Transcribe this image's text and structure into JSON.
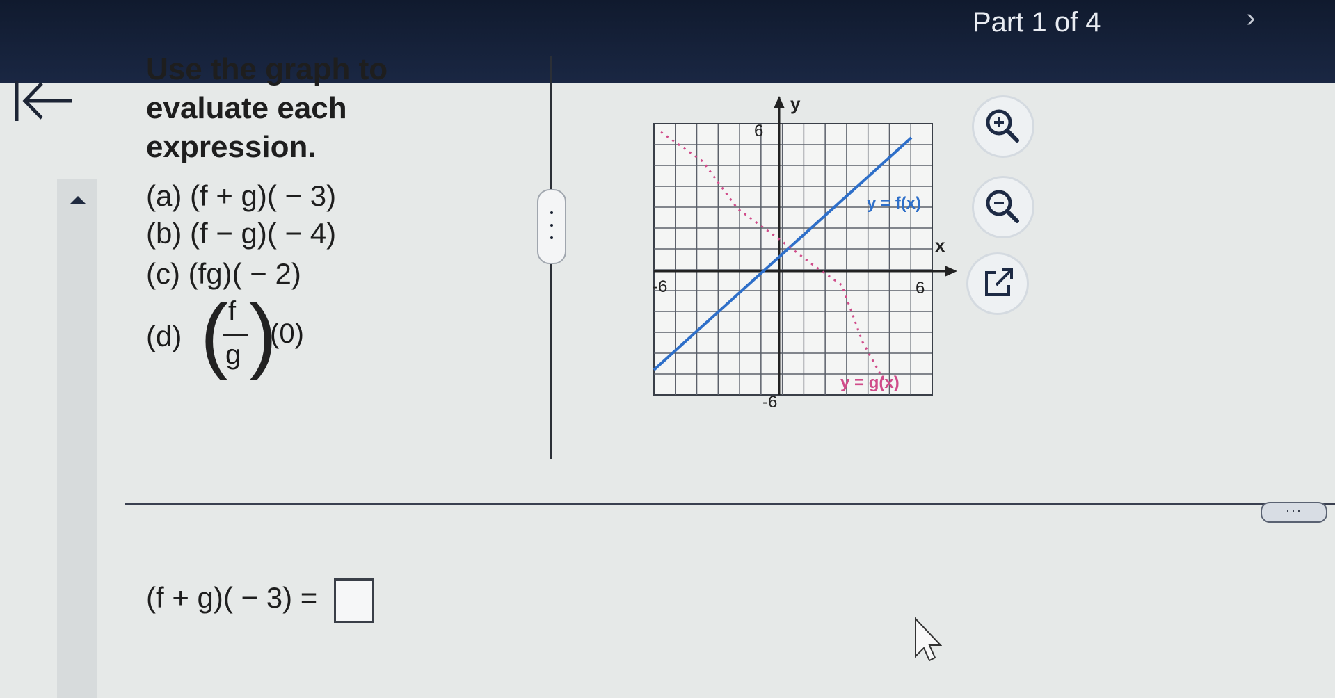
{
  "header": {
    "part_label": "Part 1 of 4",
    "next_icon": "chevron-right-icon",
    "back_icon": "back-to-start-icon"
  },
  "question": {
    "title_lines": [
      "Use the graph to",
      "evaluate each",
      "expression."
    ],
    "items": [
      {
        "label": "(a)",
        "expression": "(f + g)( − 3)"
      },
      {
        "label": "(b)",
        "expression": "(f − g)( − 4)"
      },
      {
        "label": "(c)",
        "expression": "(fg)( − 2)"
      }
    ],
    "item_d": {
      "label": "(d)",
      "numerator": "f",
      "denominator": "g",
      "argument": "(0)"
    }
  },
  "graph": {
    "x_axis_label": "x",
    "y_axis_label": "y",
    "tick_neg_x": "-6",
    "tick_pos_x": "6",
    "tick_pos_y": "6",
    "tick_neg_y": "-6",
    "f_label": "y = f(x)",
    "g_label": "y = g(x)",
    "f_color": "#2e6fc9",
    "g_color": "#d04c8a"
  },
  "tools": {
    "zoom_in_icon": "zoom-in-icon",
    "zoom_out_icon": "zoom-out-icon",
    "popout_icon": "external-link-icon"
  },
  "answer": {
    "prompt": "(f + g)( − 3) =",
    "value": ""
  },
  "more_label": "···"
}
